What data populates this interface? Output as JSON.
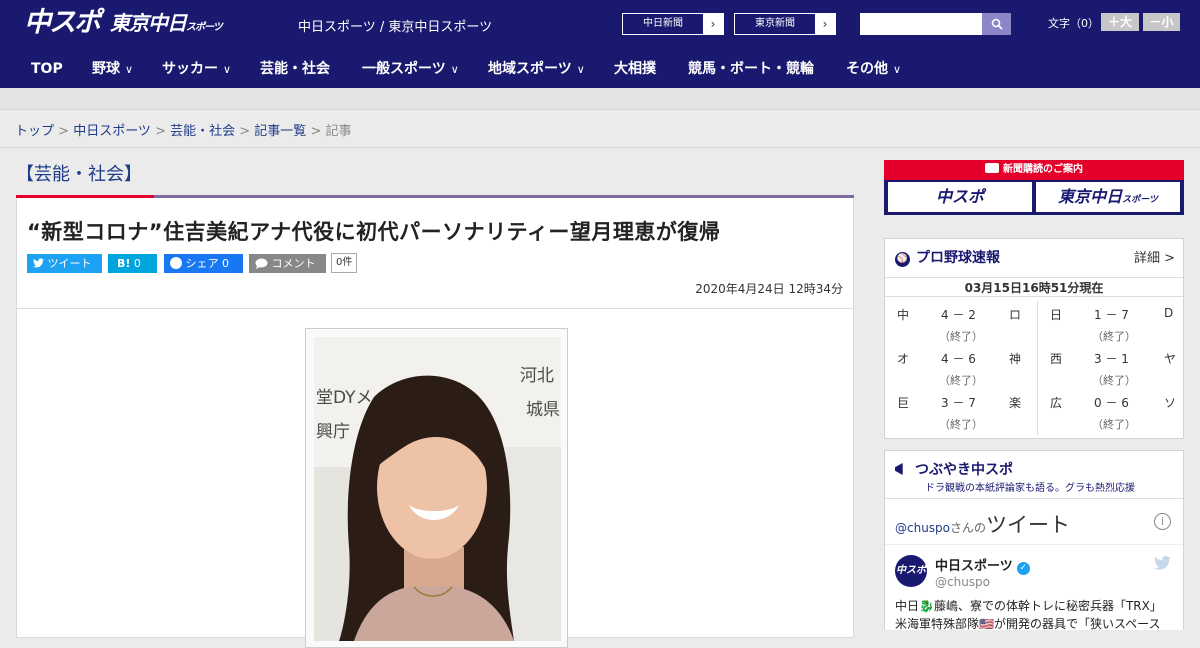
{
  "header": {
    "logo_chuspo": "中スポ",
    "logo_tokyo": "東京中日",
    "logo_tokyo_small": "スポーツ",
    "site_links": "中日スポーツ / 東京中日スポーツ",
    "paper_links": [
      {
        "label": "中日新聞",
        "arrow": "›"
      },
      {
        "label": "東京新聞",
        "arrow": "›"
      }
    ],
    "search": {
      "placeholder": "",
      "icon": "search-icon"
    },
    "font_size_label": "文字（0）",
    "font_bigger": "＋大",
    "font_smaller": "－小"
  },
  "nav": {
    "chevron": "∨",
    "items": [
      {
        "label": "TOP"
      },
      {
        "label": "野球"
      },
      {
        "label": "サッカー"
      },
      {
        "label": "芸能・社会"
      },
      {
        "label": "一般スポーツ"
      },
      {
        "label": "地域スポーツ"
      },
      {
        "label": "大相撲"
      },
      {
        "label": "競馬・ボート・競輪"
      },
      {
        "label": "その他"
      }
    ]
  },
  "breadcrumb": {
    "items": [
      "トップ",
      "中日スポーツ",
      "芸能・社会",
      "記事一覧"
    ],
    "sep": " > ",
    "current": "記事"
  },
  "category": "【芸能・社会】",
  "article": {
    "headline": "“新型コロナ”住吉美紀アナ代役に初代パーソナリティー望月理恵が復帰",
    "share": {
      "tweet": "ツイート",
      "hatena": "B!",
      "hatena_count": "0",
      "facebook": "シェア",
      "facebook_count": "0",
      "comment": "コメント",
      "comment_count": "0件"
    },
    "date": "2020年4月24日 12時34分",
    "photo_backdrop": [
      "河北",
      "堂DYメ",
      "城県、",
      "興庁"
    ]
  },
  "sidebar": {
    "promo": {
      "title": "新聞購読のご案内",
      "chuspo": "中スポ",
      "tokyo": "東京中日",
      "tokyo_small": "スポーツ"
    },
    "baseball": {
      "title": "プロ野球速報",
      "detail": "詳細 >",
      "as_of": "03月15日16時51分現在",
      "games": [
        {
          "home": "中",
          "score": "4 － 2",
          "away": "ロ",
          "status": "（終了）"
        },
        {
          "home": "オ",
          "score": "4 － 6",
          "away": "神",
          "status": "（終了）"
        },
        {
          "home": "巨",
          "score": "3 － 7",
          "away": "楽",
          "status": "（終了）"
        },
        {
          "home": "日",
          "score": "1 － 7",
          "away": "D",
          "status": "（終了）"
        },
        {
          "home": "西",
          "score": "3 － 1",
          "away": "ヤ",
          "status": "（終了）"
        },
        {
          "home": "広",
          "score": "0 － 6",
          "away": "ソ",
          "status": "（終了）"
        }
      ]
    },
    "tweets": {
      "title": "つぶやき中スポ",
      "subtitle": "ドラ観戦の本紙評論家も語る。グラも熱烈応援",
      "account": "@chuspo",
      "title_mid": "さんの",
      "title_big": "ツイート",
      "info": "i",
      "avatar": "中スポ",
      "name": "中日スポーツ",
      "verified": "✓",
      "handle": "@chuspo",
      "text_line1": "中日🐉藤嶋、寮での体幹トレに秘密兵器「TRX」",
      "text_line2": "米海軍特殊部隊🇺🇸が開発の器具で「狭いスペース"
    }
  },
  "colors": {
    "navy": "#1a1970",
    "red": "#e4002b",
    "purple": "#7e6ba4",
    "twitter": "#1da1f2",
    "facebook": "#1877f2",
    "hatena": "#00a4de"
  }
}
